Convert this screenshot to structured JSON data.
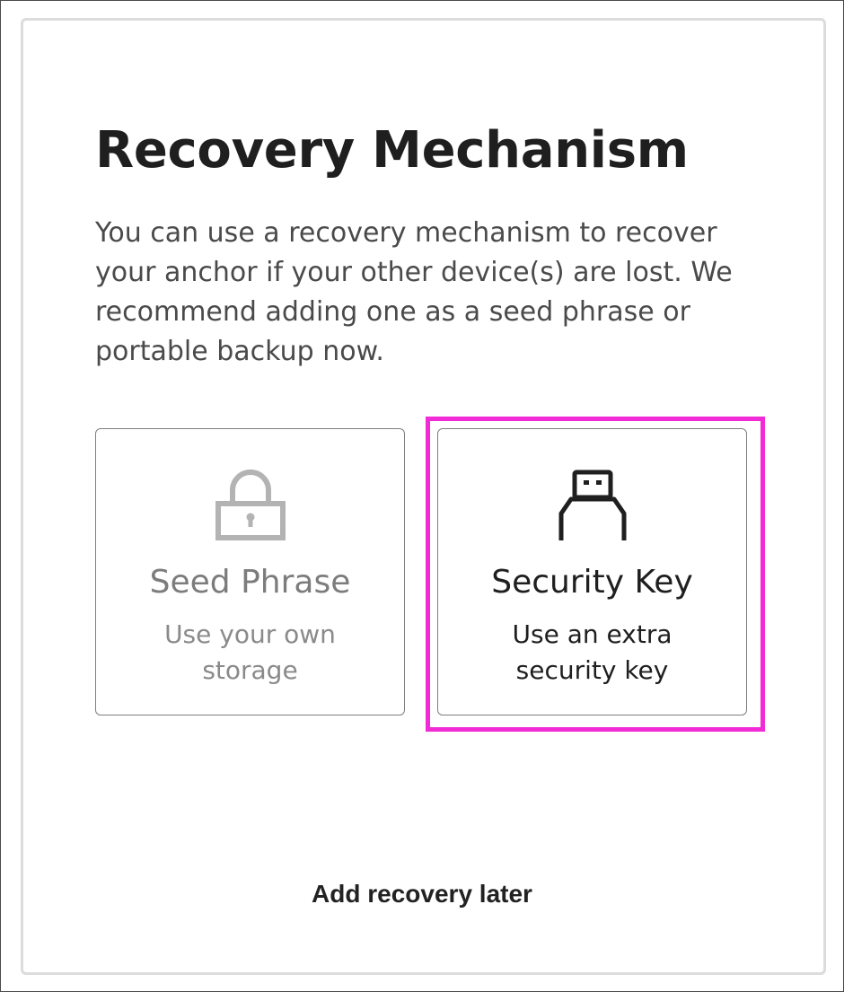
{
  "dialog": {
    "title": "Recovery Mechanism",
    "description": "You can use a recovery mechanism to recover your anchor if your other device(s) are lost. We recommend adding one as a seed phrase or portable backup now."
  },
  "options": [
    {
      "id": "seed-phrase",
      "icon": "lock-icon",
      "title": "Seed Phrase",
      "subtitle_line1": "Use your own",
      "subtitle_line2": "storage",
      "state": "disabled"
    },
    {
      "id": "security-key",
      "icon": "usb-key-icon",
      "title": "Security Key",
      "subtitle_line1": "Use an extra",
      "subtitle_line2": "security key",
      "state": "enabled"
    }
  ],
  "skip_link": "Add recovery later",
  "colors": {
    "highlight": "#f12bd6",
    "text_primary": "#1f1f1f",
    "text_disabled": "#7c7c7c",
    "card_border": "#dcdcdc"
  }
}
